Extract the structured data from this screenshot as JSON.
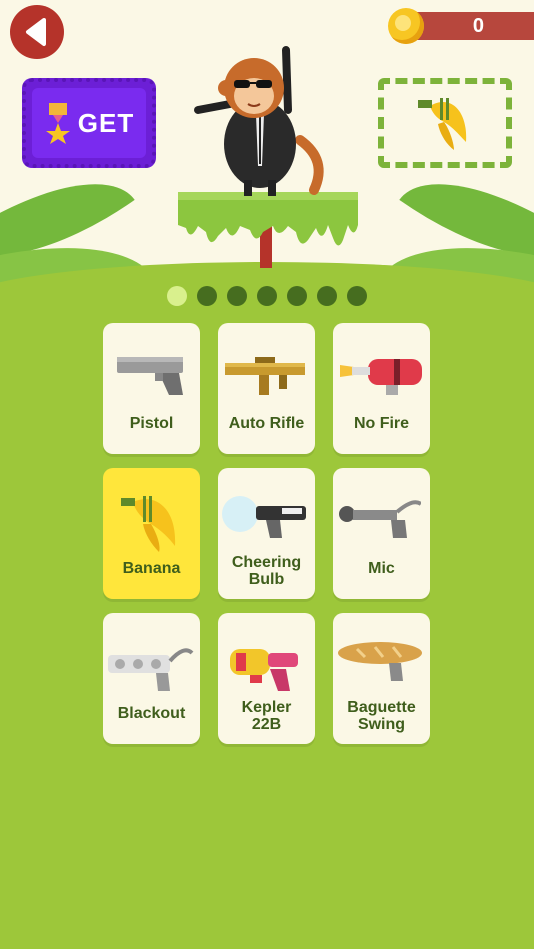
{
  "header": {
    "coins": "0",
    "get_label": "GET"
  },
  "pagination": {
    "pages": 7,
    "current": 1
  },
  "weapons": [
    {
      "id": "pistol",
      "label": "Pistol",
      "two_line": false
    },
    {
      "id": "auto-rifle",
      "label": "Auto Rifle",
      "two_line": false
    },
    {
      "id": "no-fire",
      "label": "No Fire",
      "two_line": false
    },
    {
      "id": "banana",
      "label": "Banana",
      "two_line": false,
      "selected": true
    },
    {
      "id": "cheering-bulb",
      "label": "Cheering\nBulb",
      "two_line": true
    },
    {
      "id": "mic",
      "label": "Mic",
      "two_line": false
    },
    {
      "id": "blackout",
      "label": "Blackout",
      "two_line": false
    },
    {
      "id": "kepler-22b",
      "label": "Kepler\n22B",
      "two_line": true
    },
    {
      "id": "baguette-swing",
      "label": "Baguette\nSwing",
      "two_line": true
    }
  ],
  "colors": {
    "background": "#9dc73a",
    "card": "#fbf8e6",
    "selected": "#ffe63b",
    "label": "#3f5e1c",
    "back": "#b5332a",
    "get": "#6c1fd6"
  }
}
